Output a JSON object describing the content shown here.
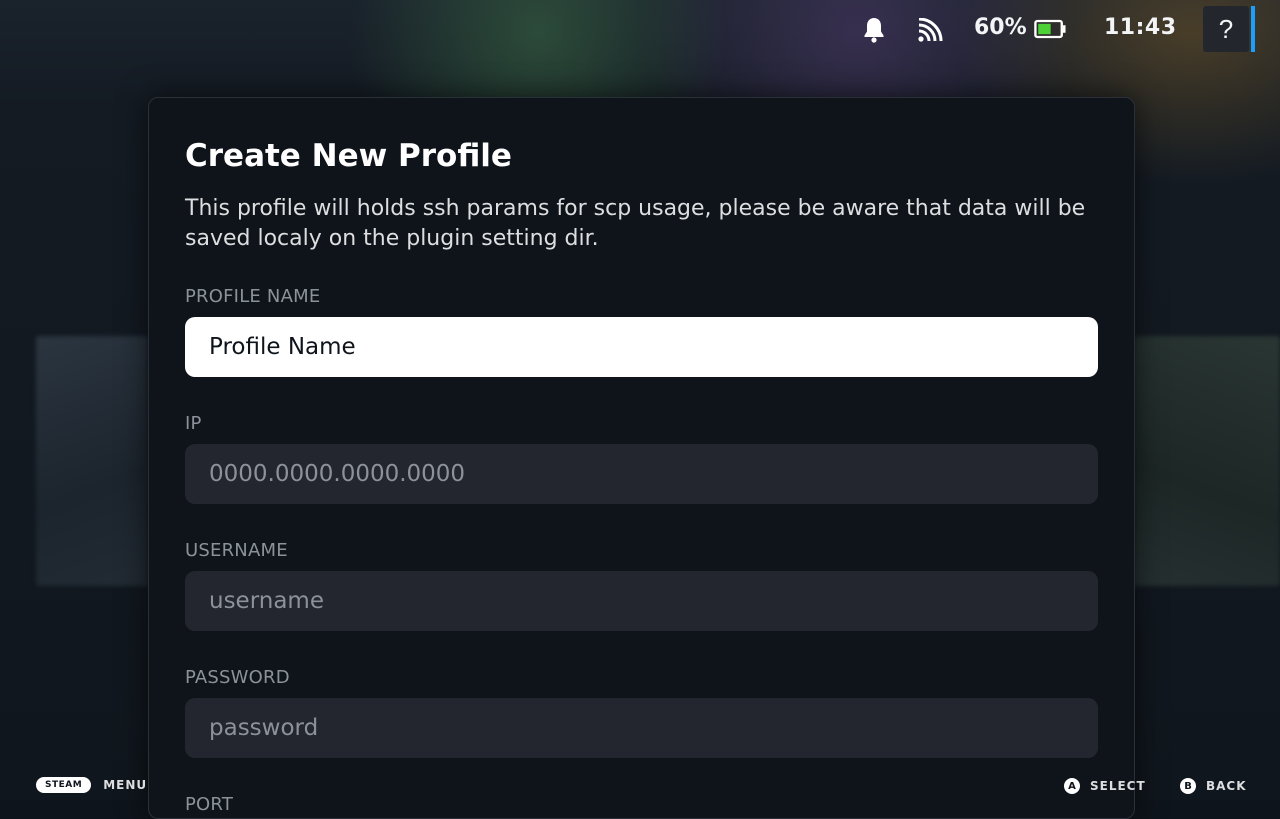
{
  "status_bar": {
    "battery_percent": "60%",
    "battery_level": 0.6,
    "clock": "11:43",
    "help_label": "?",
    "icons": [
      "bell-icon",
      "wifi-icon",
      "battery-icon"
    ],
    "accent_color": "#1a9fff",
    "battery_fill_color": "#4cd137"
  },
  "dialog": {
    "title": "Create New Profile",
    "description": "This profile will holds ssh params for scp usage, please be aware that data will be saved localy on the plugin setting dir.",
    "fields": {
      "profile_name": {
        "label": "PROFILE NAME",
        "value": "Profile Name",
        "placeholder": ""
      },
      "ip": {
        "label": "IP",
        "value": "",
        "placeholder": "0000.0000.0000.0000"
      },
      "username": {
        "label": "USERNAME",
        "value": "",
        "placeholder": "username"
      },
      "password": {
        "label": "PASSWORD",
        "value": "",
        "placeholder": "password"
      },
      "port": {
        "label": "PORT"
      }
    }
  },
  "footer": {
    "steam_label": "STEAM",
    "menu_label": "MENU",
    "select_glyph": "A",
    "select_label": "SELECT",
    "back_glyph": "B",
    "back_label": "BACK"
  }
}
